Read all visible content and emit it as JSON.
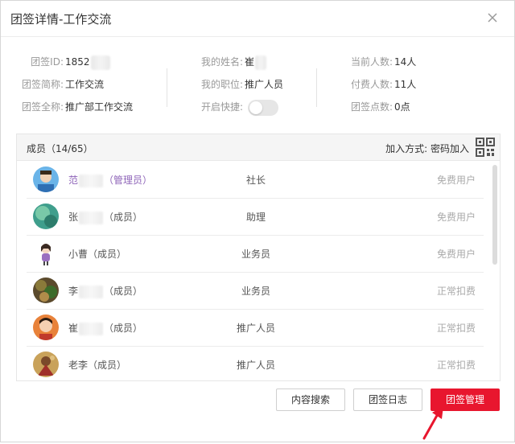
{
  "dialog": {
    "title": "团签详情-工作交流"
  },
  "info": {
    "id_label": "团签ID:",
    "id_value": "1852",
    "short_label": "团签简称:",
    "short_value": "工作交流",
    "full_label": "团签全称:",
    "full_value": "推广部工作交流",
    "myname_label": "我的姓名:",
    "myname_value": "崔",
    "mypos_label": "我的职位:",
    "mypos_value": "推广人员",
    "quick_label": "开启快捷:",
    "quick_enabled": false,
    "cur_label": "当前人数:",
    "cur_value": "14人",
    "paid_label": "付费人数:",
    "paid_value": "11人",
    "points_label": "团签点数:",
    "points_value": "0点"
  },
  "members": {
    "count_label": "成员（14/65）",
    "join_label": "加入方式: 密码加入",
    "rows": [
      {
        "name_prefix": "范",
        "name_suffix": "（管理员）",
        "role": "社长",
        "status": "免费用户",
        "admin": true
      },
      {
        "name_prefix": "张",
        "name_suffix": "（成员）",
        "role": "助理",
        "status": "免费用户",
        "admin": false
      },
      {
        "name_prefix": "小曹",
        "name_suffix": "（成员）",
        "role": "业务员",
        "status": "免费用户",
        "admin": false
      },
      {
        "name_prefix": "李",
        "name_suffix": "（成员）",
        "role": "业务员",
        "status": "正常扣费",
        "admin": false
      },
      {
        "name_prefix": "崔",
        "name_suffix": "（成员）",
        "role": "推广人员",
        "status": "正常扣费",
        "admin": false
      },
      {
        "name_prefix": "老李",
        "name_suffix": "（成员）",
        "role": "推广人员",
        "status": "正常扣费",
        "admin": false
      }
    ]
  },
  "buttons": {
    "search": "内容搜索",
    "log": "团签日志",
    "manage": "团签管理"
  },
  "colors": {
    "primary": "#e8162e",
    "admin_name": "#8e64b8",
    "status_gray": "#aaaaaa"
  },
  "icons": {
    "close": "close-icon",
    "qr": "qr-code-icon",
    "arrow": "red-arrow-icon"
  }
}
